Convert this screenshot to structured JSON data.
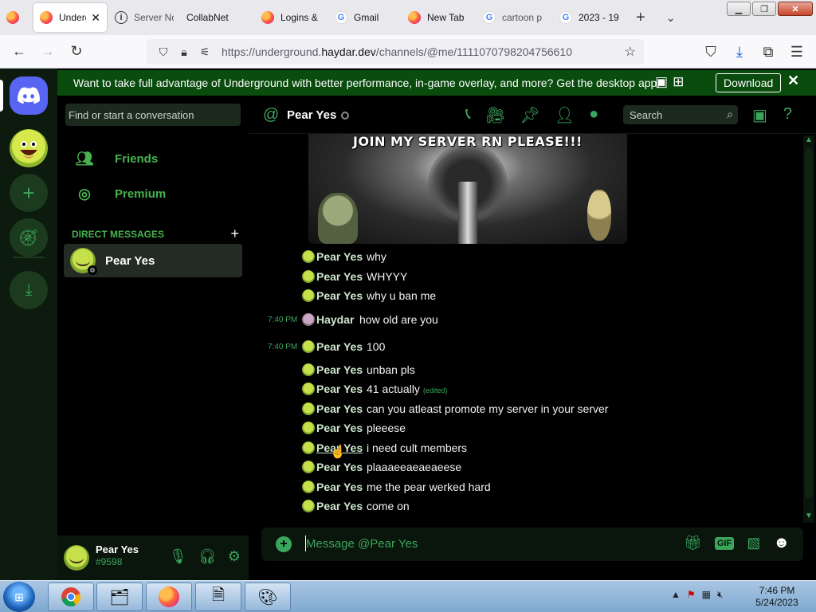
{
  "browser": {
    "tabs": [
      {
        "label": "",
        "icon": "firefox-icon"
      },
      {
        "label": "Undergrou",
        "icon": "firefox-icon",
        "active": true
      },
      {
        "label": "Server No",
        "icon": "info-icon"
      },
      {
        "label": "CollabNet",
        "icon": ""
      },
      {
        "label": "Logins &",
        "icon": "firefox-icon"
      },
      {
        "label": "Gmail",
        "icon": "google-icon"
      },
      {
        "label": "New Tab",
        "icon": "firefox-icon"
      },
      {
        "label": "cartoon p",
        "icon": "google-icon"
      },
      {
        "label": "2023 - 19",
        "icon": "google-icon"
      }
    ],
    "url": {
      "prefix": "https://underground.",
      "host": "haydar.dev",
      "path": "/channels/@me/1111070798204756610"
    }
  },
  "banner": {
    "text": "Want to take full advantage of Underground with better performance, in-game overlay, and more? Get the desktop app!",
    "download_label": "Download"
  },
  "sidebar": {
    "search_placeholder": "Find or start a conversation",
    "nav": [
      {
        "label": "Friends",
        "icon": "friends-icon"
      },
      {
        "label": "Premium",
        "icon": "nitro-icon"
      }
    ],
    "dm_header": "DIRECT MESSAGES",
    "dms": [
      {
        "name": "Pear Yes",
        "status": "offline"
      }
    ],
    "user": {
      "name": "Pear Yes",
      "tag": "#9598"
    }
  },
  "chat": {
    "title": "Pear Yes",
    "search_placeholder": "Search",
    "image_caption": "JOIN MY SERVER RN PLEASE!!!",
    "messages": [
      {
        "time": "",
        "author": "Pear Yes",
        "text": "why"
      },
      {
        "time": "",
        "author": "Pear Yes",
        "text": "WHYYY"
      },
      {
        "time": "",
        "author": "Pear Yes",
        "text": "why u ban me"
      },
      {
        "time": "7:40 PM",
        "author": "Haydar",
        "text": "how old are you"
      },
      {
        "time": "7:40 PM",
        "author": "Pear Yes",
        "text": "100"
      },
      {
        "time": "",
        "author": "Pear Yes",
        "text": "unban pls"
      },
      {
        "time": "",
        "author": "Pear Yes",
        "text": "41 actually",
        "edited": "(edited)"
      },
      {
        "time": "",
        "author": "Pear Yes",
        "text": "can you atleast promote my server in your server"
      },
      {
        "time": "",
        "author": "Pear Yes",
        "text": "pleeese"
      },
      {
        "time": "",
        "author": "Pear Yes",
        "text": "i need cult members",
        "hover": true
      },
      {
        "time": "",
        "author": "Pear Yes",
        "text": "plaaaeeaeaeaeese"
      },
      {
        "time": "",
        "author": "Pear Yes",
        "text": "me the pear werked hard"
      },
      {
        "time": "",
        "author": "Pear Yes",
        "text": "come on"
      }
    ],
    "composer_placeholder": "Message @Pear Yes",
    "gif_label": "GIF"
  },
  "taskbar": {
    "time": "7:46 PM",
    "date": "5/24/2023"
  },
  "colors": {
    "accent": "#3ba55d",
    "banner": "#0a4b0e",
    "discord": "#5865f2"
  }
}
